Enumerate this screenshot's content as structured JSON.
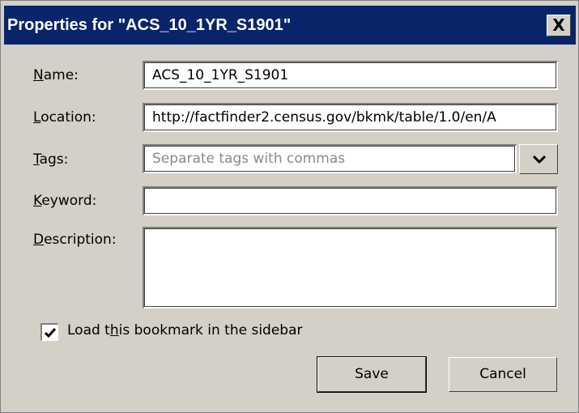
{
  "window": {
    "title": "Properties for \"ACS_10_1YR_S1901\"",
    "close_glyph": "X"
  },
  "form": {
    "name": {
      "label_ul": "N",
      "label_rest": "ame:",
      "value": "ACS_10_1YR_S1901"
    },
    "location": {
      "label_ul": "L",
      "label_rest": "ocation:",
      "value": "http://factfinder2.census.gov/bkmk/table/1.0/en/A"
    },
    "tags": {
      "label_ul": "T",
      "label_rest": "ags:",
      "value": "",
      "placeholder": "Separate tags with commas"
    },
    "keyword": {
      "label_ul": "K",
      "label_rest": "eyword:",
      "value": ""
    },
    "description": {
      "label_ul": "D",
      "label_rest": "escription:",
      "value": ""
    }
  },
  "sidebar_option": {
    "label_pre": "Load t",
    "label_ul": "h",
    "label_post": "is bookmark in the sidebar",
    "checked": true
  },
  "buttons": {
    "save": "Save",
    "cancel": "Cancel"
  },
  "icons": {
    "dropdown": "chevron-down-icon",
    "check": "checkmark-icon",
    "close": "close-icon"
  }
}
